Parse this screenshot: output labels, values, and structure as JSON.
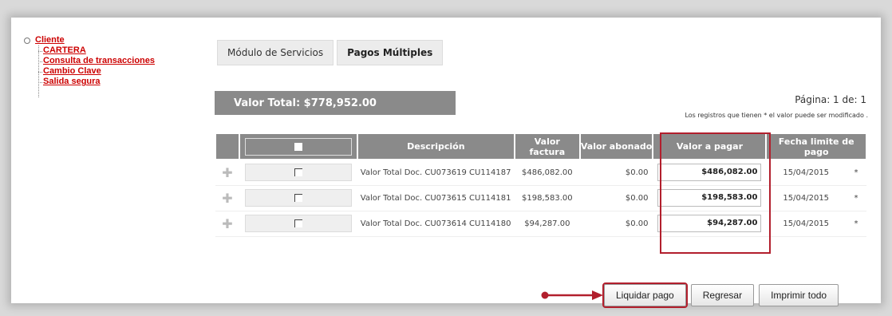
{
  "nav": {
    "root_label": "Cliente",
    "items": [
      {
        "label": "CARTERA"
      },
      {
        "label": "Consulta de transacciones"
      },
      {
        "label": "Cambio Clave"
      },
      {
        "label": "Salida segura"
      }
    ]
  },
  "tabs": [
    {
      "label": "Módulo de Servicios",
      "active": false
    },
    {
      "label": "Pagos Múltiples",
      "active": true
    }
  ],
  "summary": {
    "total_label": "Valor Total: $778,952.00",
    "page_label": "Página: 1 de: 1",
    "note": "Los registros que tienen * el valor puede ser modificado ."
  },
  "table": {
    "headers": [
      "Descripción",
      "Valor factura",
      "Valor abonado",
      "Valor a pagar",
      "Fecha limite de pago"
    ],
    "rows": [
      {
        "desc": "Valor Total Doc. CU073619 CU114187",
        "factura": "$486,082.00",
        "abonado": "$0.00",
        "pagar": "$486,082.00",
        "fecha": "15/04/2015",
        "mark": "*"
      },
      {
        "desc": "Valor Total Doc. CU073615 CU114181",
        "factura": "$198,583.00",
        "abonado": "$0.00",
        "pagar": "$198,583.00",
        "fecha": "15/04/2015",
        "mark": "*"
      },
      {
        "desc": "Valor Total Doc. CU073614 CU114180",
        "factura": "$94,287.00",
        "abonado": "$0.00",
        "pagar": "$94,287.00",
        "fecha": "15/04/2015",
        "mark": "*"
      }
    ]
  },
  "buttons": {
    "liquidar": "Liquidar pago",
    "regresar": "Regresar",
    "imprimir": "Imprimir todo"
  },
  "colors": {
    "accent": "#b21f2d",
    "header_gray": "#8a8a8a",
    "link": "#cc0000"
  }
}
